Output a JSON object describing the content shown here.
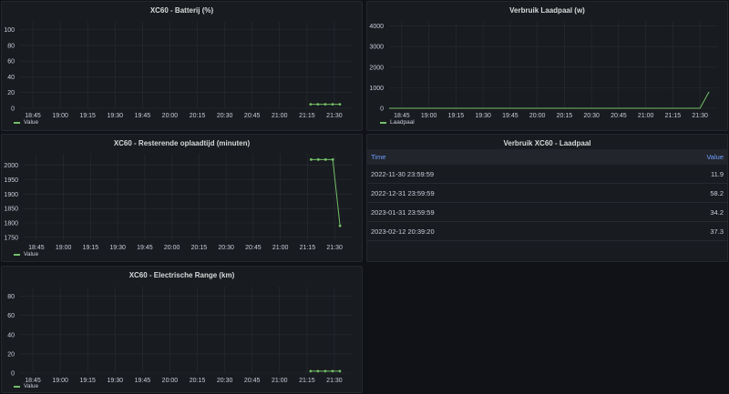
{
  "panels": {
    "battery": {
      "title": "XC60 - Batterij (%)",
      "legend": "Value",
      "color": "#73bf69"
    },
    "charger": {
      "title": "Verbruik Laadpaal (w)",
      "legend": "Laadpaal",
      "color": "#73bf69"
    },
    "remaining": {
      "title": "XC60 - Resterende oplaadtijd (minuten)",
      "legend": "Value",
      "color": "#73bf69"
    },
    "usage_table": {
      "title": "Verbruik XC60 - Laadpaal",
      "columns": [
        "Time",
        "Value"
      ],
      "rows": [
        [
          "2022-11-30 23:59:59",
          "11.9"
        ],
        [
          "2022-12-31 23:59:59",
          "58.2"
        ],
        [
          "2023-01-31 23:59:59",
          "34.2"
        ],
        [
          "2023-02-12 20:39:20",
          "37.3"
        ]
      ]
    },
    "range": {
      "title": "XC60 - Electrische Range (km)",
      "legend": "Value",
      "color": "#73bf69"
    }
  },
  "chart_data": [
    {
      "id": "battery",
      "type": "line",
      "title": "XC60 - Batterij (%)",
      "x_ticks": [
        "18:45",
        "19:00",
        "19:15",
        "19:30",
        "19:45",
        "20:00",
        "20:15",
        "20:30",
        "20:45",
        "21:00",
        "21:15",
        "21:30"
      ],
      "y_ticks": [
        0,
        20,
        40,
        60,
        80,
        100
      ],
      "ylim": [
        0,
        110
      ],
      "xlim": [
        "18:38",
        "21:40"
      ],
      "series": [
        {
          "name": "Value",
          "x": [
            "21:17",
            "21:21",
            "21:25",
            "21:29",
            "21:33"
          ],
          "y": [
            5,
            5,
            5,
            5,
            5
          ]
        }
      ],
      "grid": true,
      "legend": "bottom-left"
    },
    {
      "id": "charger",
      "type": "line",
      "title": "Verbruik Laadpaal (w)",
      "x_ticks": [
        "18:45",
        "19:00",
        "19:15",
        "19:30",
        "19:45",
        "20:00",
        "20:15",
        "20:30",
        "20:45",
        "21:00",
        "21:15",
        "21:30"
      ],
      "y_ticks": [
        0,
        1000,
        2000,
        3000,
        4000
      ],
      "ylim": [
        0,
        4200
      ],
      "xlim": [
        "18:38",
        "21:40"
      ],
      "series": [
        {
          "name": "Laadpaal",
          "x": [
            "18:38",
            "21:30",
            "21:35"
          ],
          "y": [
            0,
            0,
            800
          ]
        }
      ],
      "grid": true,
      "legend": "bottom-left"
    },
    {
      "id": "remaining",
      "type": "line",
      "title": "XC60 - Resterende oplaadtijd (minuten)",
      "x_ticks": [
        "18:45",
        "19:00",
        "19:15",
        "19:30",
        "19:45",
        "20:00",
        "20:15",
        "20:30",
        "20:45",
        "21:00",
        "21:15",
        "21:30"
      ],
      "y_ticks": [
        1750,
        1800,
        1850,
        1900,
        1950,
        2000
      ],
      "ylim": [
        1740,
        2040
      ],
      "xlim": [
        "18:38",
        "21:40"
      ],
      "series": [
        {
          "name": "Value",
          "x": [
            "21:17",
            "21:21",
            "21:25",
            "21:29",
            "21:33"
          ],
          "y": [
            2020,
            2020,
            2020,
            2020,
            1790
          ]
        }
      ],
      "grid": true,
      "legend": "bottom-left"
    },
    {
      "id": "range",
      "type": "line",
      "title": "XC60 - Electrische Range (km)",
      "x_ticks": [
        "18:45",
        "19:00",
        "19:15",
        "19:30",
        "19:45",
        "20:00",
        "20:15",
        "20:30",
        "20:45",
        "21:00",
        "21:15",
        "21:30"
      ],
      "y_ticks": [
        0,
        20,
        40,
        60,
        80
      ],
      "ylim": [
        0,
        90
      ],
      "xlim": [
        "18:38",
        "21:40"
      ],
      "series": [
        {
          "name": "Value",
          "x": [
            "21:17",
            "21:21",
            "21:25",
            "21:29",
            "21:33"
          ],
          "y": [
            2,
            2,
            2,
            2,
            2
          ]
        }
      ],
      "grid": true,
      "legend": "bottom-left"
    }
  ]
}
